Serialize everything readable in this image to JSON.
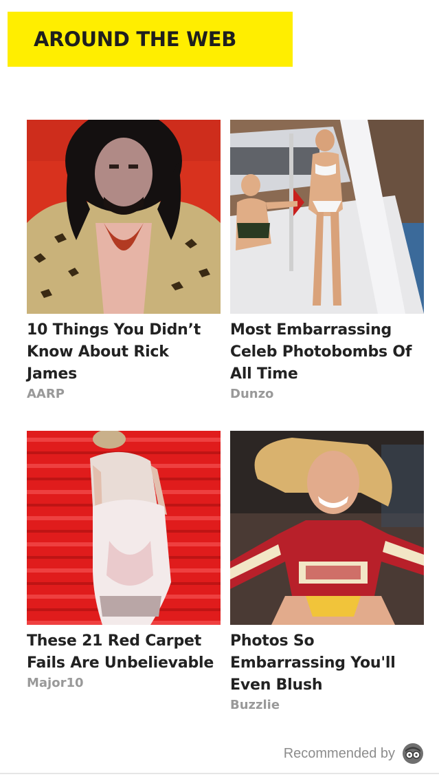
{
  "header": {
    "title": "AROUND THE WEB",
    "accent_color": "#ffee00"
  },
  "cards": [
    {
      "title": "10 Things You Didn’t Know About Rick James",
      "source": "AARP",
      "image_icon": "portrait-photo"
    },
    {
      "title": "Most Embarrassing Celeb Photobombs Of All Time",
      "source": "Dunzo",
      "image_icon": "yacht-photo"
    },
    {
      "title": "These 21 Red Carpet Fails Are Unbelievable",
      "source": "Major10",
      "image_icon": "red-carpet-photo"
    },
    {
      "title": "Photos So Embarrassing You'll Even Blush",
      "source": "Buzzlie",
      "image_icon": "cheerleader-photo"
    }
  ],
  "footer": {
    "label": "Recommended by",
    "logo_icon": "outbrain-logo-icon"
  }
}
